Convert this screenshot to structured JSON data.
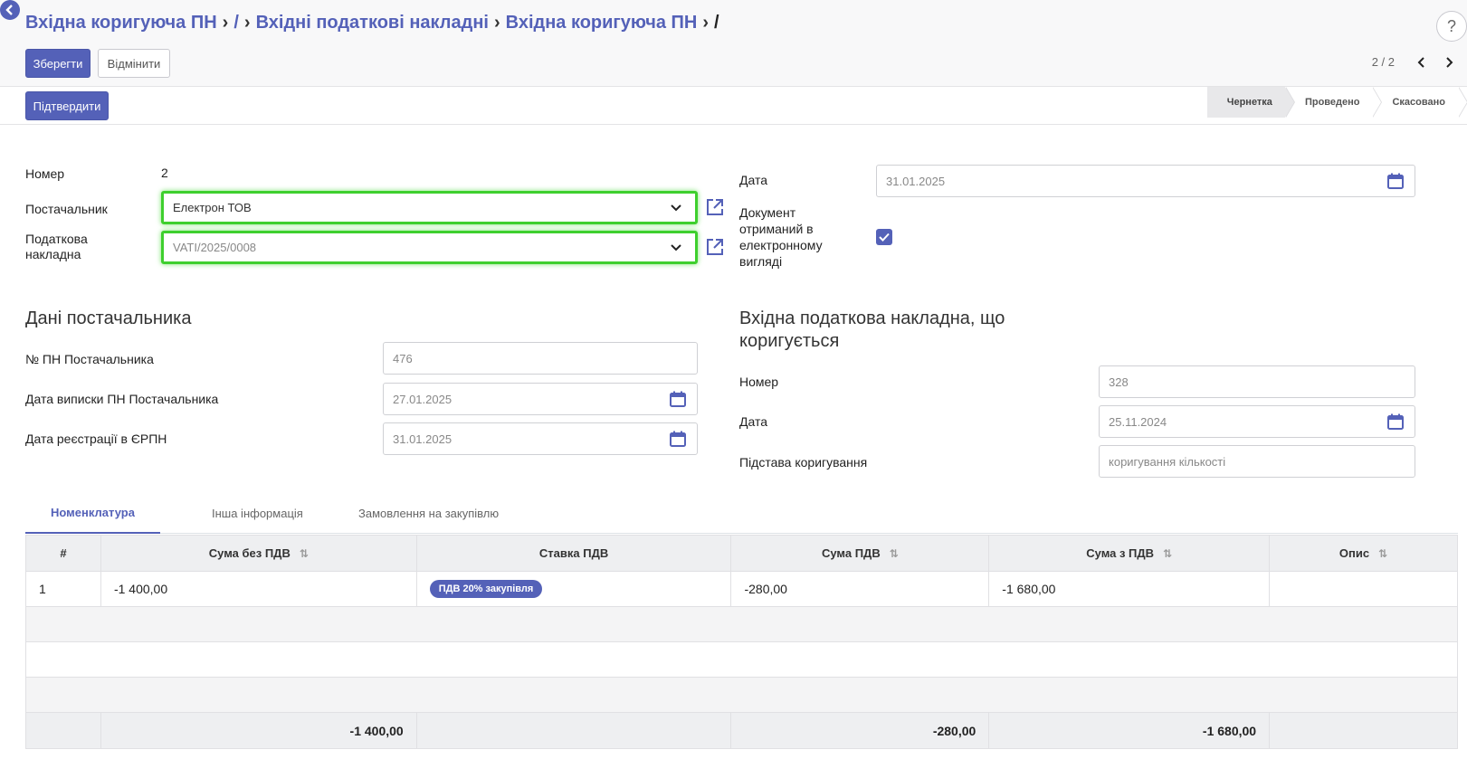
{
  "breadcrumb": {
    "item1": "Вхідна коригуюча ПН",
    "slash1": "/",
    "item2": "Вхідні податкові накладні",
    "item3": "Вхідна коригуюча ПН",
    "slash2": "/"
  },
  "toolbar": {
    "save_label": "Зберегти",
    "cancel_label": "Відмінити",
    "confirm_label": "Підтвердити"
  },
  "pager": {
    "text": "2 / 2"
  },
  "help": "?",
  "stages": [
    "Чернетка",
    "Проведено",
    "Скасовано"
  ],
  "form": {
    "number_label": "Номер",
    "number_value": "2",
    "supplier_label": "Постачальник",
    "supplier_value": "Електрон ТОВ",
    "tax_invoice_label": "Податкова накладна",
    "tax_invoice_value": "VATI/2025/0008",
    "date_label": "Дата",
    "date_value": "31.01.2025",
    "electronic_label": "Документ отриманий в електронному вигляді",
    "electronic_checked": true
  },
  "supplier_section": {
    "title": "Дані постачальника",
    "tn_label": "№ ПН Постачальника",
    "tn_value": "476",
    "issue_date_label": "Дата виписки ПН Постачальника",
    "issue_date_value": "27.01.2025",
    "reg_date_label": "Дата реєстрації в ЄРПН",
    "reg_date_value": "31.01.2025"
  },
  "corrected_section": {
    "title": "Вхідна податкова накладна, що коригується",
    "number_label": "Номер",
    "number_value": "328",
    "date_label": "Дата",
    "date_value": "25.11.2024",
    "reason_label": "Підстава коригування",
    "reason_value": "коригування кількості"
  },
  "tabs": [
    "Номенклатура",
    "Інша інформація",
    "Замовлення на закупівлю"
  ],
  "table": {
    "headers": [
      "#",
      "Сума без ПДВ",
      "Ставка ПДВ",
      "Сума ПДВ",
      "Сума з ПДВ",
      "Опис"
    ],
    "rows": [
      {
        "num": "1",
        "amount_net": "-1 400,00",
        "vat_rate": "ПДВ 20% закупівля",
        "vat": "-280,00",
        "amount_gross": "-1 680,00",
        "desc": ""
      }
    ],
    "totals": {
      "amount_net": "-1 400,00",
      "vat": "-280,00",
      "amount_gross": "-1 680,00"
    }
  },
  "colors": {
    "accent": "#5461b8",
    "highlight": "#3ecf2e"
  }
}
